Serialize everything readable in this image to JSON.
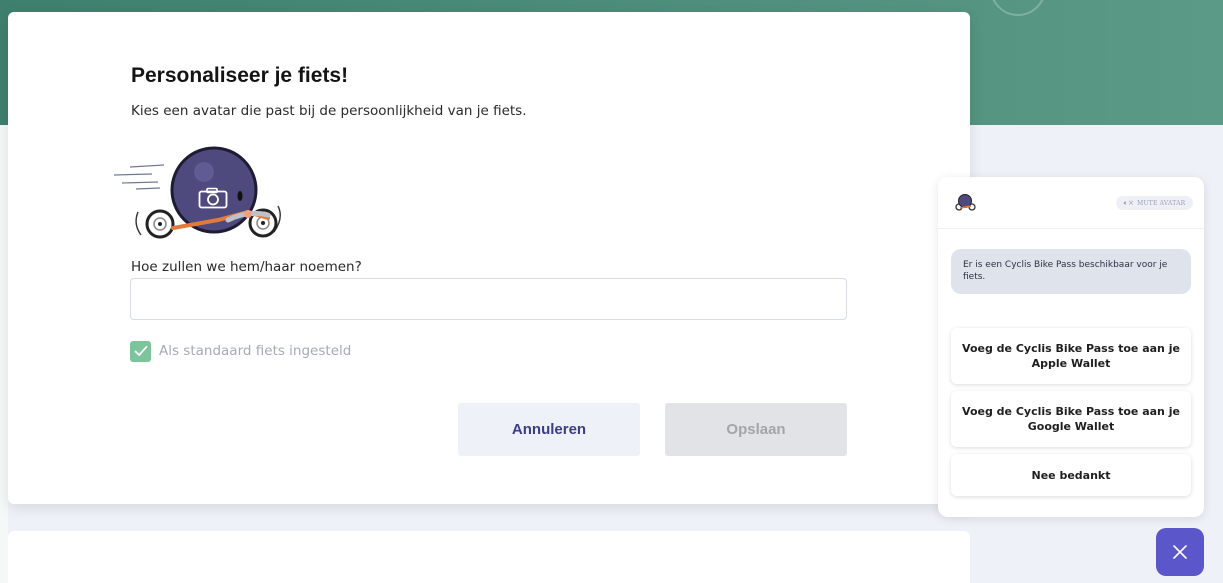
{
  "modal": {
    "title": "Personaliseer je fiets!",
    "subtitle": "Kies een avatar die past bij de persoonlijkheid van je fiets.",
    "avatar_icon": "camera-icon",
    "name_label": "Hoe zullen we hem/haar noemen?",
    "name_value": "",
    "name_placeholder": "",
    "default_checkbox": {
      "label": "Als standaard fiets ingesteld",
      "checked": true
    },
    "cancel_label": "Annuleren",
    "save_label": "Opslaan",
    "save_enabled": false
  },
  "chat": {
    "mute_label": "MUTE AVATAR",
    "mute_icon": "speaker-muted-icon",
    "message": "Er is een Cyclis Bike Pass beschikbaar voor je fiets.",
    "actions": [
      {
        "label": "Voeg de Cyclis Bike Pass toe aan je Apple Wallet"
      },
      {
        "label": "Voeg de Cyclis Bike Pass toe aan je Google Wallet"
      },
      {
        "label": "Nee bedankt"
      }
    ],
    "close_icon": "close-icon"
  },
  "colors": {
    "header_band": "#4a8a77",
    "accent_purple": "#5b56c9",
    "button_text_purple": "#3d3d86",
    "checkbox_green": "#7cc49b",
    "avatar_purple": "#4e4a7e"
  }
}
